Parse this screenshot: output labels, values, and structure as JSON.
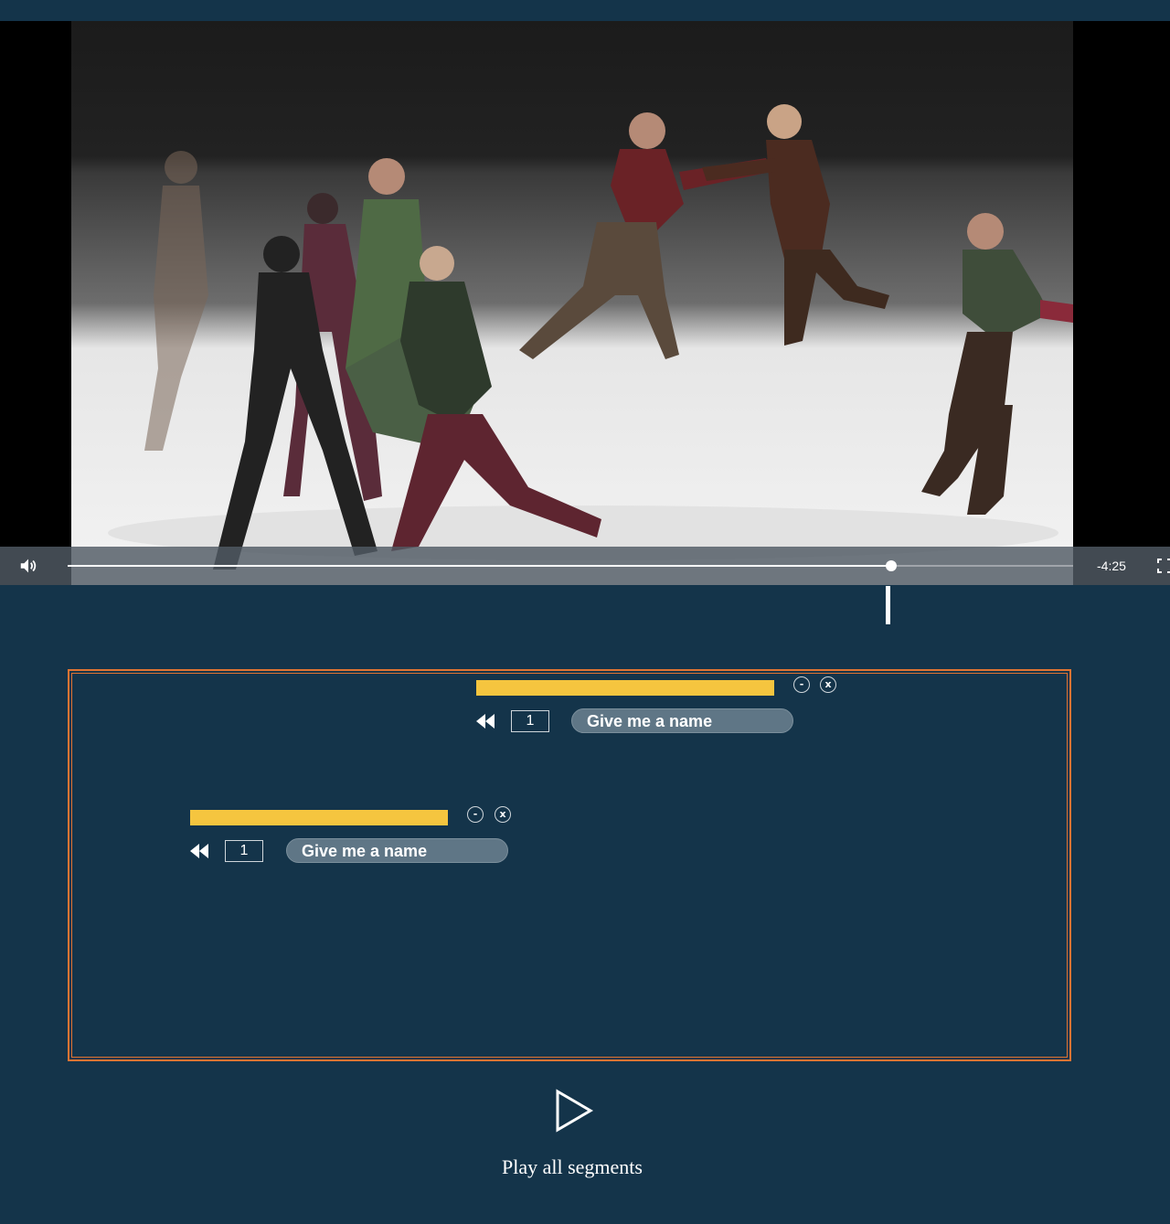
{
  "player": {
    "time_remaining": "-4:25",
    "progress_fraction": 0.819,
    "icons": {
      "volume": "volume-icon",
      "fullscreen": "fullscreen-icon"
    }
  },
  "segments": [
    {
      "number": "1",
      "name_placeholder": "Give me a name",
      "minimize_label": "-",
      "close_label": "x"
    },
    {
      "number": "1",
      "name_placeholder": "Give me a name",
      "minimize_label": "-",
      "close_label": "x"
    }
  ],
  "play_all": {
    "label": "Play all segments",
    "icon": "play-icon"
  },
  "colors": {
    "background": "#14344a",
    "segment_bar": "#f5c53f",
    "timeline_border": "#e07433",
    "name_pill": "#5f7686"
  }
}
